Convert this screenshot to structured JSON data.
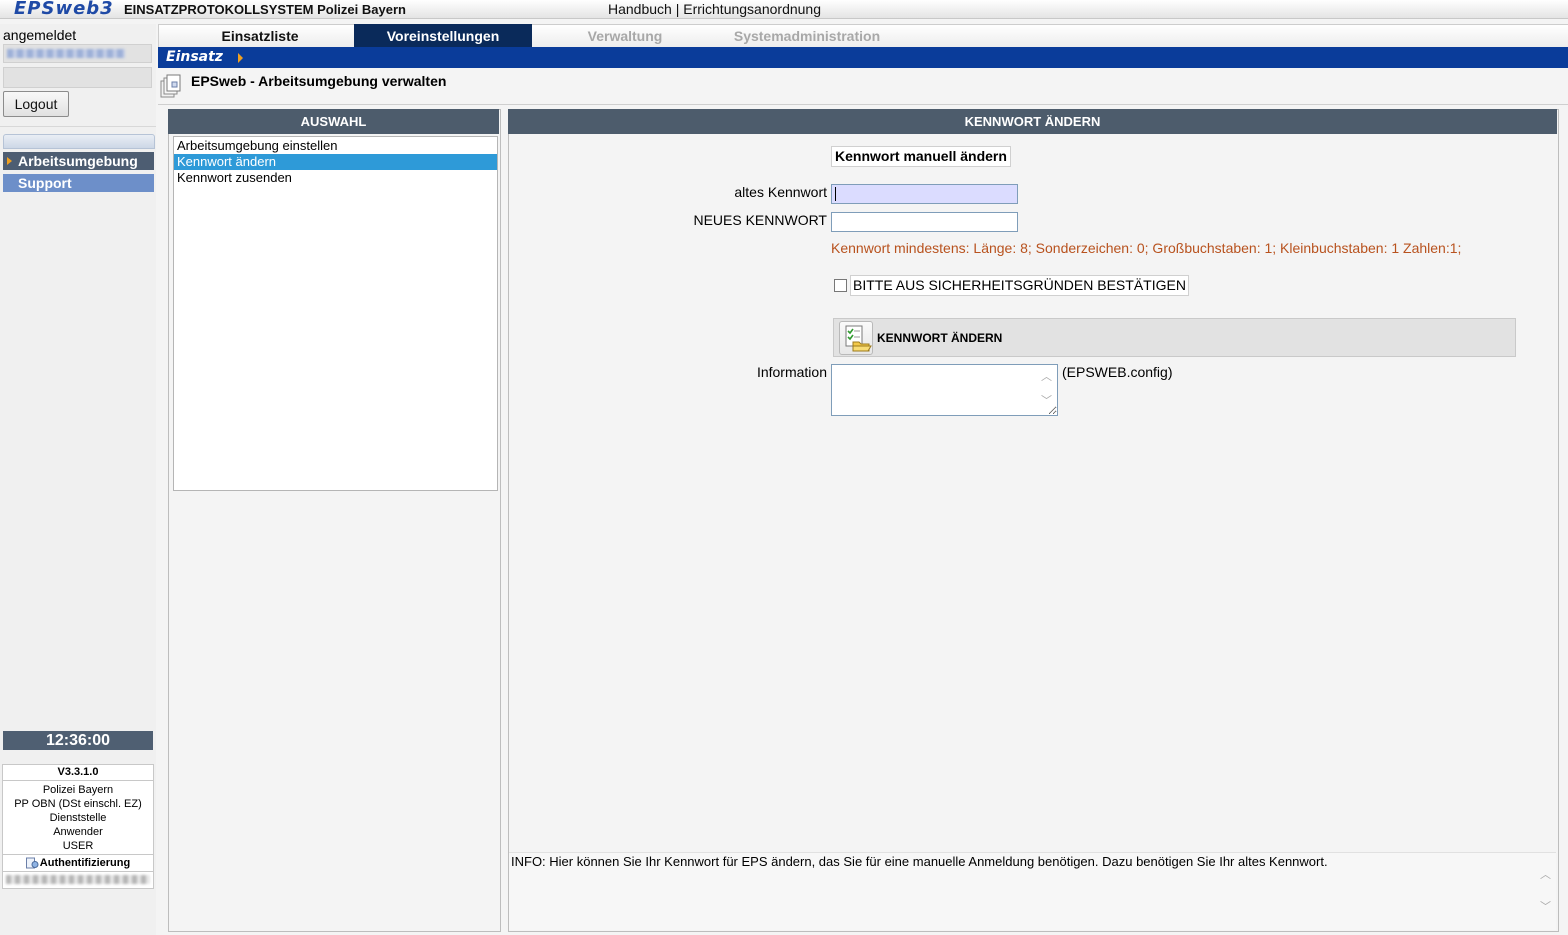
{
  "header": {
    "logo": "EPSweb3",
    "system_title": "EINSATZPROTOKOLLSYSTEM Polizei Bayern",
    "links": [
      "Handbuch",
      "Errichtungsanordnung"
    ],
    "link_separator": " | "
  },
  "sidebar": {
    "login_label": "angemeldet",
    "logout_label": "Logout",
    "nav": [
      {
        "label": "Arbeitsumgebung",
        "active": true
      },
      {
        "label": "Support",
        "active": false
      }
    ],
    "clock": "12:36:00",
    "version": "V3.3.1.0",
    "info_lines": [
      "Polizei Bayern",
      "PP OBN (DSt einschl. EZ)",
      "Dienststelle",
      "Anwender",
      "USER"
    ],
    "auth_label": "Authentifizierung"
  },
  "tabs": [
    {
      "label": "Einsatzliste",
      "state": "normal"
    },
    {
      "label": "Voreinstellungen",
      "state": "active"
    },
    {
      "label": "Verwaltung",
      "state": "disabled"
    },
    {
      "label": "Systemadministration",
      "state": "disabled"
    }
  ],
  "breadcrumb": {
    "label": "Einsatz"
  },
  "page_title": "EPSweb - Arbeitsumgebung verwalten",
  "selection_panel": {
    "header": "AUSWAHL",
    "items": [
      {
        "label": "Arbeitsumgebung einstellen",
        "selected": false
      },
      {
        "label": "Kennwort ändern",
        "selected": true
      },
      {
        "label": "Kennwort zusenden",
        "selected": false
      }
    ]
  },
  "password_panel": {
    "header": "KENNWORT ÄNDERN",
    "subheading": "Kennwort manuell ändern",
    "old_password_label": "altes Kennwort",
    "old_password_value": "",
    "new_password_label": "NEUES KENNWORT",
    "new_password_value": "",
    "requirements_hint": "Kennwort mindestens: Länge: 8; Sonderzeichen: 0; Großbuchstaben: 1; Kleinbuchstaben: 1 Zahlen:1;",
    "confirm_checkbox_label": "BITTE AUS SICHERHEITSGRÜNDEN BESTÄTIGEN",
    "confirm_checked": false,
    "submit_label": "KENNWORT ÄNDERN",
    "information_label": "Information",
    "information_value": "",
    "config_label": "(EPSWEB.config)",
    "info_text": "INFO: Hier können Sie Ihr Kennwort für EPS ändern, das Sie für eine manuelle Anmeldung benötigen. Dazu benötigen Sie Ihr altes Kennwort."
  },
  "colors": {
    "brand_blue": "#0a3c9a",
    "active_tab": "#0a2a5a",
    "panel_header": "#4d5c6c",
    "selection": "#2e9ad8",
    "hint_text": "#b8521e",
    "input_focus": "#dbdcff"
  },
  "icons": {
    "page": "document-stack-icon",
    "submit": "checklist-folder-icon",
    "auth": "lock-user-icon"
  }
}
